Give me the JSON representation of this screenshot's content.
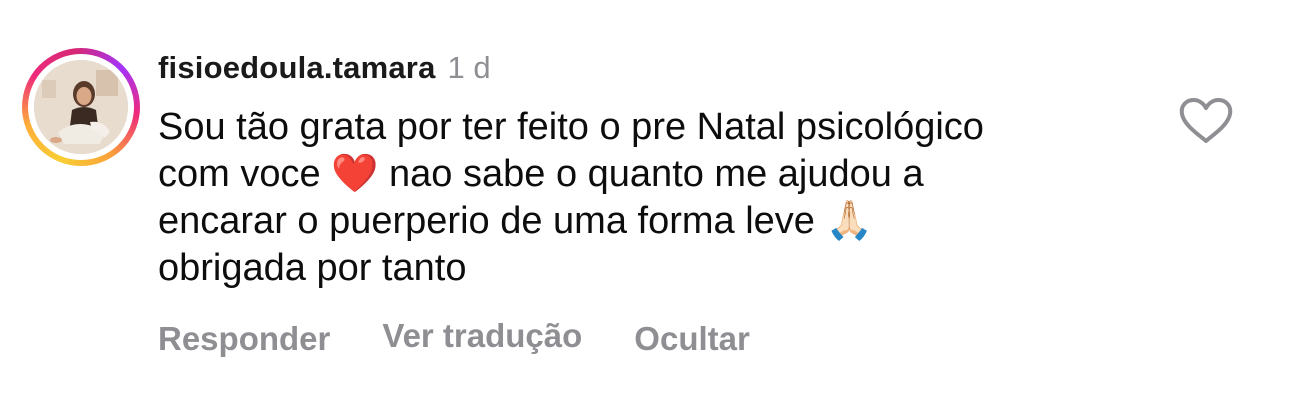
{
  "comment": {
    "username": "fisioedoula.tamara",
    "timestamp": "1 d",
    "text_lines": [
      "Sou tão grata por ter feito o pre Natal psicológico",
      "com voce ❤️ nao sabe o quanto me ajudou a",
      "encarar o puerperio de uma forma leve 🙏🏻",
      "obrigada por tanto"
    ],
    "liked": false
  },
  "actions": {
    "reply_label": "Responder",
    "translate_label": "Ver tradução",
    "hide_label": "Ocultar"
  },
  "icons": {
    "like": "heart-outline-icon",
    "avatar_ring": "story-ring"
  },
  "colors": {
    "secondary_text": "#8e8e93",
    "ring_gradient": [
      "#f9ce34",
      "#ee2a7b",
      "#a334fa"
    ]
  }
}
